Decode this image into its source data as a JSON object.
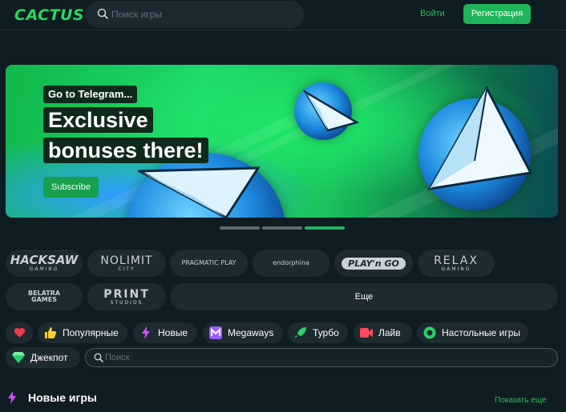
{
  "header": {
    "logo": "CACTUS",
    "search_placeholder": "Поиск игры",
    "login_label": "Войти",
    "register_label": "Регистрация"
  },
  "banner": {
    "tag_line": "Go to Telegram...",
    "headline_1": "Exclusive",
    "headline_2": "bonuses there!",
    "button_label": "Subscribe",
    "slide_indicator": {
      "count": 3,
      "active_index": 2
    }
  },
  "providers": {
    "items": [
      {
        "name": "HACKSAW",
        "sub": "GAMING"
      },
      {
        "name": "NOLIMIT",
        "sub": "CITY"
      },
      {
        "name": "PRAGMATIC PLAY",
        "sub": ""
      },
      {
        "name": "endorphina",
        "sub": ""
      },
      {
        "name": "PLAY'n GO",
        "sub": ""
      },
      {
        "name": "RELAX",
        "sub": "GAMING"
      },
      {
        "name": "BELATRA GAMES",
        "sub": ""
      },
      {
        "name": "PRINT",
        "sub": "STUDIOS"
      }
    ],
    "more_label": "Еще"
  },
  "categories": {
    "items": [
      {
        "label": "",
        "icon": "heart-icon"
      },
      {
        "label": "Популярные",
        "icon": "thumbs-up-icon"
      },
      {
        "label": "Новые",
        "icon": "lightning-icon"
      },
      {
        "label": "Megaways",
        "icon": "megaways-icon"
      },
      {
        "label": "Турбо",
        "icon": "rocket-icon"
      },
      {
        "label": "Лайв",
        "icon": "live-camera-icon"
      },
      {
        "label": "Настольные игры",
        "icon": "poker-chip-icon"
      },
      {
        "label": "Джекпот",
        "icon": "diamond-icon"
      }
    ],
    "search_placeholder": "Поиск"
  },
  "new_games": {
    "title": "Новые игры",
    "show_more_label": "Показать еще"
  },
  "colors": {
    "background": "#0f1c22",
    "accent_green": "#1fb45a",
    "pill_bg": "#1d2a30"
  }
}
